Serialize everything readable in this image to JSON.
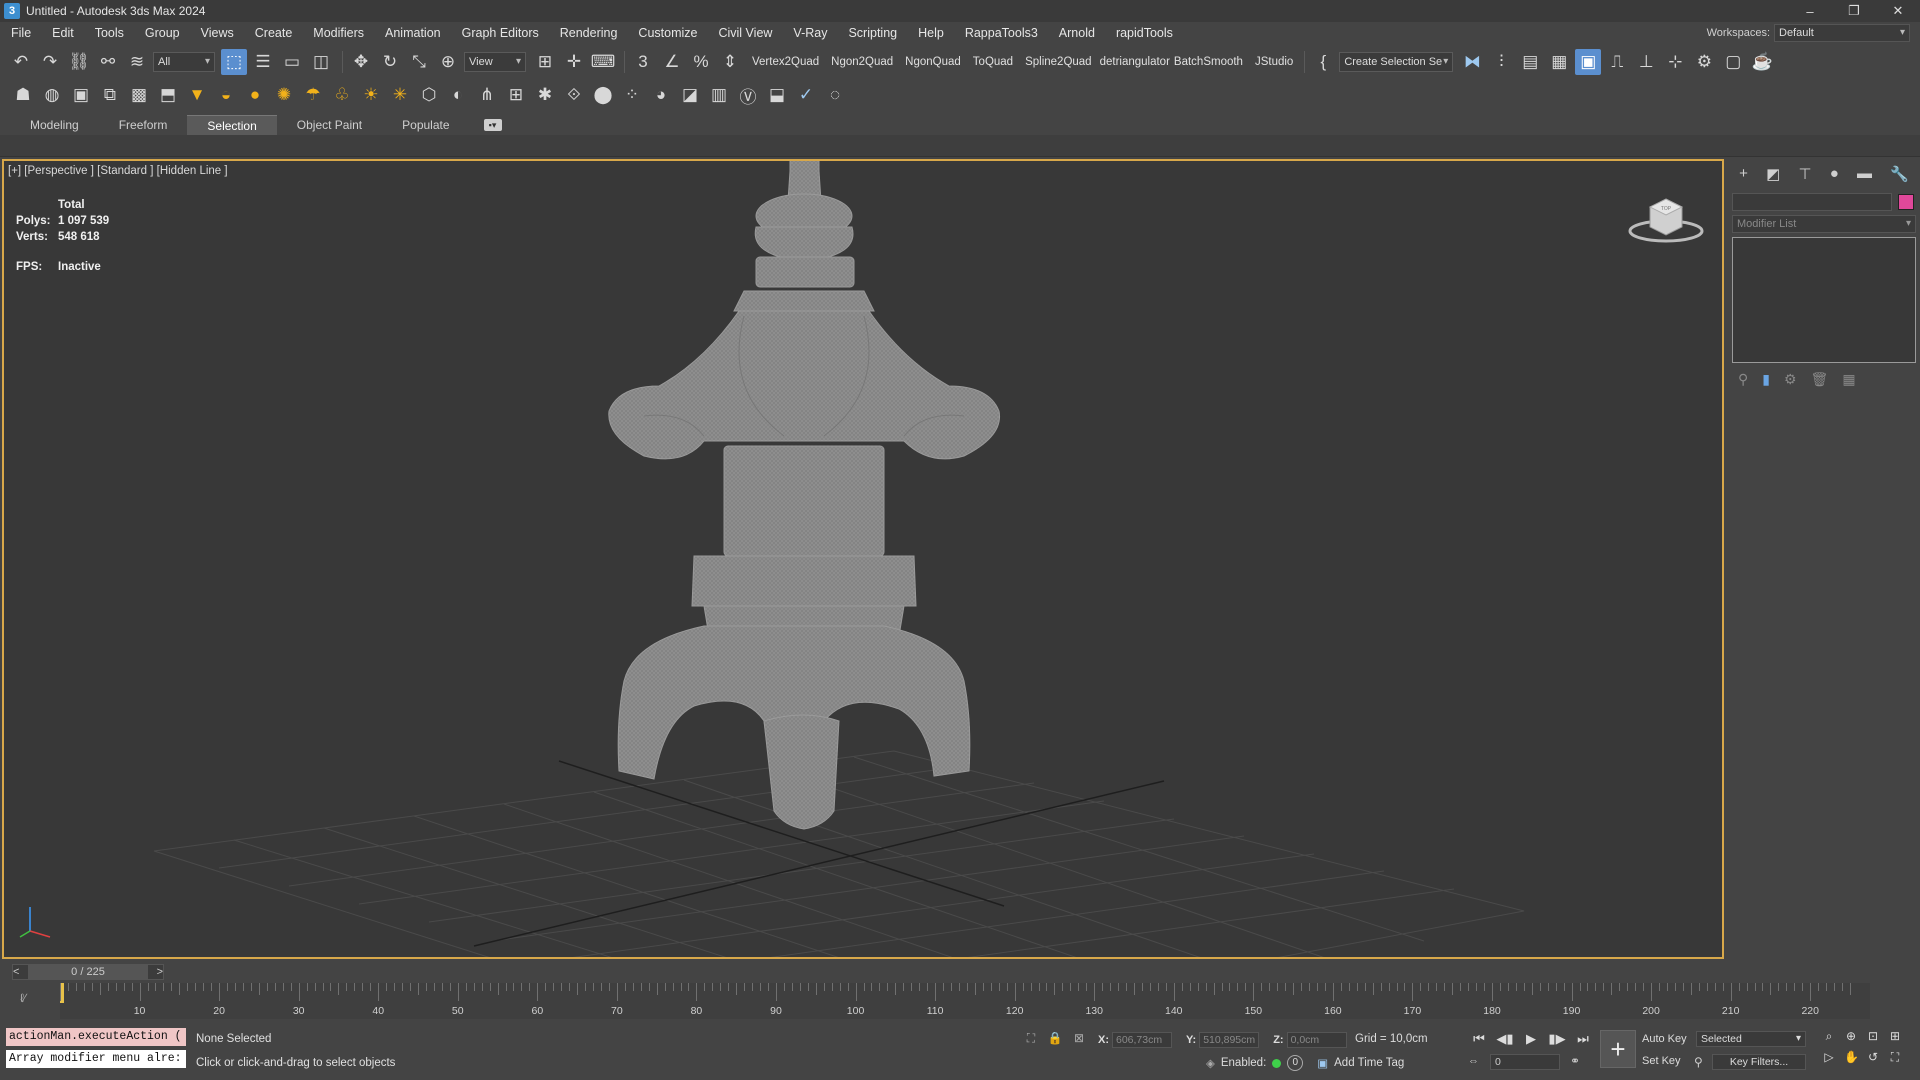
{
  "window": {
    "title": "Untitled - Autodesk 3ds Max 2024",
    "controls": [
      "–",
      "❐",
      "✕"
    ]
  },
  "menu": [
    "File",
    "Edit",
    "Tools",
    "Group",
    "Views",
    "Create",
    "Modifiers",
    "Animation",
    "Graph Editors",
    "Rendering",
    "Customize",
    "Civil View",
    "V-Ray",
    "Scripting",
    "Help",
    "RappaTools3",
    "Arnold",
    "rapidTools"
  ],
  "workspace": {
    "label": "Workspaces:",
    "value": "Default"
  },
  "toolbar": {
    "selection_filter": "All",
    "ref_coord": "View",
    "script_buttons": [
      "Vertex2Quad",
      "Ngon2Quad",
      "NgonQuad",
      "ToQuad",
      "Spline2Quad",
      "detriangulator",
      "BatchSmooth",
      "JStudio"
    ],
    "named_selection": "Create Selection Se"
  },
  "ribbon_tabs": [
    {
      "label": "Modeling",
      "active": false
    },
    {
      "label": "Freeform",
      "active": false
    },
    {
      "label": "Selection",
      "active": true
    },
    {
      "label": "Object Paint",
      "active": false
    },
    {
      "label": "Populate",
      "active": false
    }
  ],
  "viewport": {
    "label": "[+] [Perspective ] [Standard ] [Hidden Line ]",
    "stats": {
      "header": "Total",
      "polys_label": "Polys:",
      "polys": "1 097 539",
      "verts_label": "Verts:",
      "verts": "548 618",
      "fps_label": "FPS:",
      "fps": "Inactive"
    },
    "viewcube_text": "TOP",
    "mesh_color": "#8a8a8a",
    "frame_color": "#d8a84a"
  },
  "command_panel": {
    "modifier_list": "Modifier List",
    "color_swatch": "#e0489a"
  },
  "timeline": {
    "frame_display": "0 / 225",
    "prev": "<",
    "next": ">",
    "tick_labels": [
      "10",
      "20",
      "30",
      "40",
      "50",
      "60",
      "70",
      "80",
      "90",
      "100",
      "110",
      "120",
      "130",
      "140",
      "150",
      "160",
      "170",
      "180",
      "190",
      "200",
      "210",
      "220"
    ],
    "max_frame": 225
  },
  "status": {
    "maxscript_line1": "actionMan.executeAction (",
    "maxscript_line2": "Array modifier menu alre:",
    "selection": "None Selected",
    "prompt": "Click or click-and-drag to select objects",
    "x_label": "X:",
    "x": "606,73cm",
    "y_label": "Y:",
    "y": "510,895cm",
    "z_label": "Z:",
    "z": "0,0cm",
    "grid": "Grid = 10,0cm",
    "enabled": "Enabled:",
    "enabled_value": "0",
    "add_time_tag": "Add Time Tag",
    "frame": "0",
    "auto_key": "Auto Key",
    "set_key": "Set Key",
    "key_mode": "Selected",
    "key_filters": "Key Filters..."
  }
}
